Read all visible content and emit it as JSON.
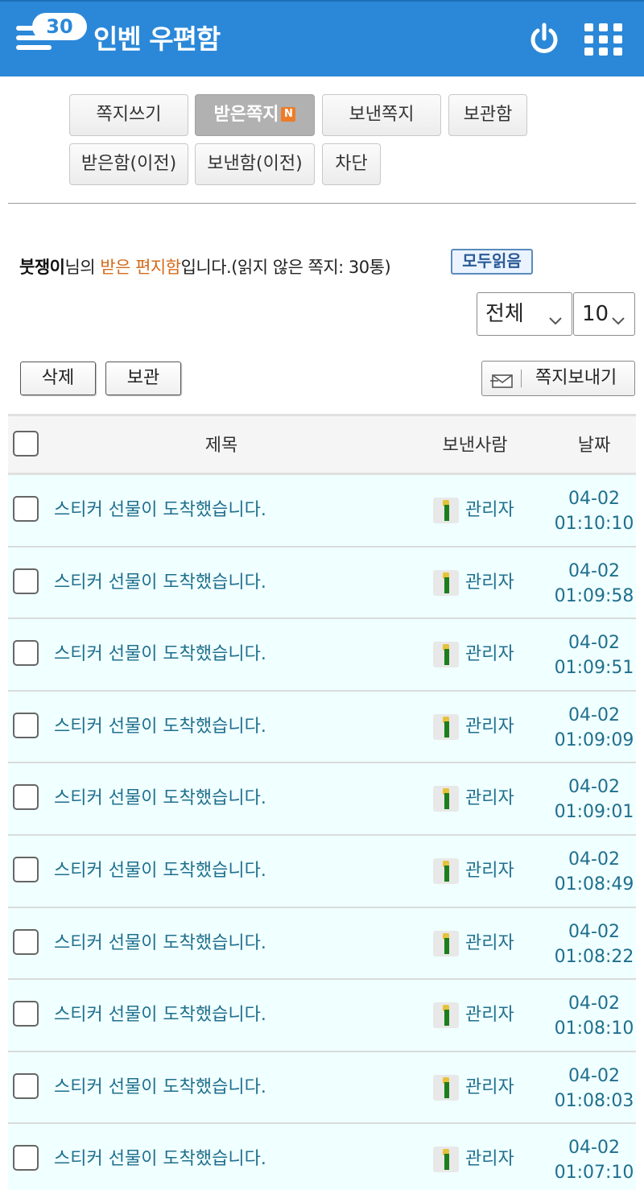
{
  "header": {
    "badge_count": "30",
    "title": "인벤 우편함"
  },
  "tabs": [
    {
      "label": "쪽지쓰기"
    },
    {
      "label": "받은쪽지",
      "new_mark": "N"
    },
    {
      "label": "보낸쪽지"
    },
    {
      "label": "보관함"
    },
    {
      "label": "받은함(이전)"
    },
    {
      "label": "보낸함(이전)"
    },
    {
      "label": "차단"
    }
  ],
  "info": {
    "user": "붓쟁이",
    "suffix_1": "님의 ",
    "box_name": "받은 편지함",
    "suffix_2": "입니다.(읽지 않은 쪽지: 30통)",
    "read_all_label": "모두읽음"
  },
  "filters": {
    "category_value": "전체",
    "page_size_value": "10"
  },
  "actions": {
    "delete_label": "삭제",
    "archive_label": "보관",
    "send_label": "쪽지보내기"
  },
  "table": {
    "headers": {
      "subject": "제목",
      "sender": "보낸사람",
      "date": "날짜"
    },
    "rows": [
      {
        "subject": "스티커 선물이 도착했습니다.",
        "sender": "관리자",
        "date": "04-02",
        "time": "01:10:10"
      },
      {
        "subject": "스티커 선물이 도착했습니다.",
        "sender": "관리자",
        "date": "04-02",
        "time": "01:09:58"
      },
      {
        "subject": "스티커 선물이 도착했습니다.",
        "sender": "관리자",
        "date": "04-02",
        "time": "01:09:51"
      },
      {
        "subject": "스티커 선물이 도착했습니다.",
        "sender": "관리자",
        "date": "04-02",
        "time": "01:09:09"
      },
      {
        "subject": "스티커 선물이 도착했습니다.",
        "sender": "관리자",
        "date": "04-02",
        "time": "01:09:01"
      },
      {
        "subject": "스티커 선물이 도착했습니다.",
        "sender": "관리자",
        "date": "04-02",
        "time": "01:08:49"
      },
      {
        "subject": "스티커 선물이 도착했습니다.",
        "sender": "관리자",
        "date": "04-02",
        "time": "01:08:22"
      },
      {
        "subject": "스티커 선물이 도착했습니다.",
        "sender": "관리자",
        "date": "04-02",
        "time": "01:08:10"
      },
      {
        "subject": "스티커 선물이 도착했습니다.",
        "sender": "관리자",
        "date": "04-02",
        "time": "01:08:03"
      },
      {
        "subject": "스티커 선물이 도착했습니다.",
        "sender": "관리자",
        "date": "04-02",
        "time": "01:07:10"
      }
    ]
  },
  "colors": {
    "header_bg": "#2b88d8",
    "link": "#1f6f8e",
    "highlight": "#d46b1c",
    "row_bg": "#f0ffff"
  }
}
